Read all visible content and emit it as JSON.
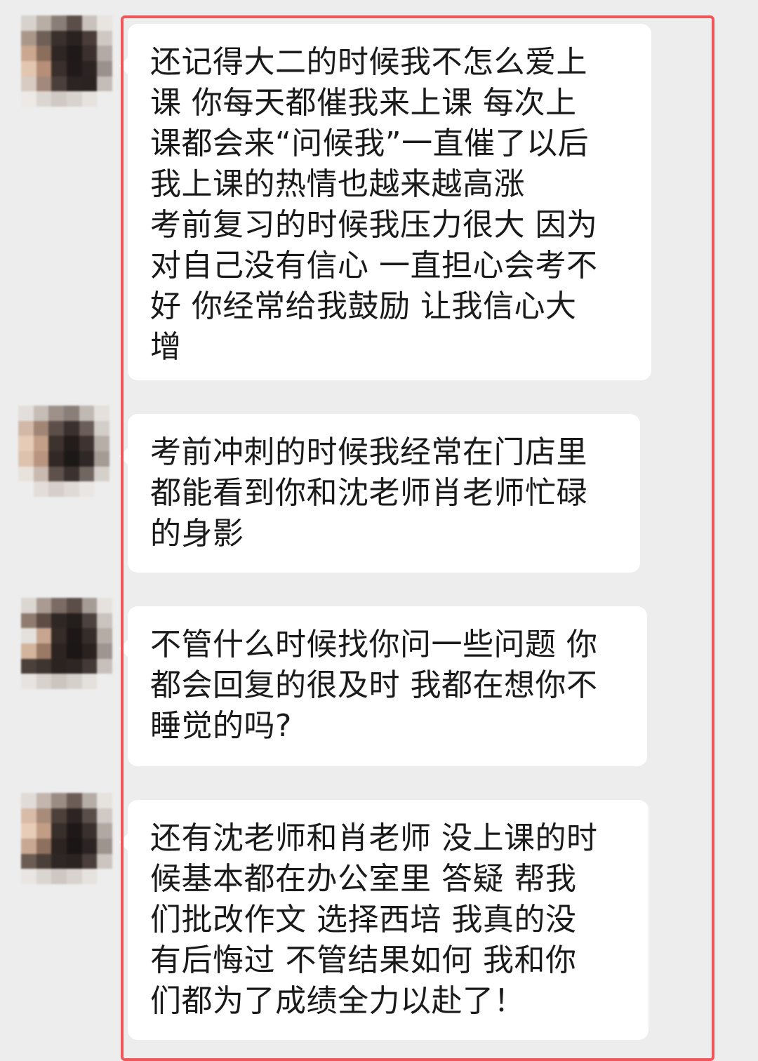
{
  "chat": {
    "messages": [
      {
        "sender": "contact",
        "text": "还记得大二的时候我不怎么爱上\n课  你每天都催我来上课 每次上\n课都会来“问候我”一直催了以后\n我上课的热情也越来越高涨\n考前复习的时候我压力很大 因为\n对自己没有信心 一直担心会考不\n好 你经常给我鼓励 让我信心大\n增"
      },
      {
        "sender": "contact",
        "text": "考前冲刺的时候我经常在门店里\n都能看到你和沈老师肖老师忙碌\n的身影"
      },
      {
        "sender": "contact",
        "text": "不管什么时候找你问一些问题 你\n都会回复的很及时 我都在想你不\n睡觉的吗?"
      },
      {
        "sender": "contact",
        "text": "还有沈老师和肖老师 没上课的时\n候基本都在办公室里 答疑 帮我\n们批改作文 选择西培 我真的没\n有后悔过 不管结果如何 我和你\n们都为了成绩全力以赴了！"
      }
    ]
  },
  "colors": {
    "background": "#ededed",
    "bubble": "#ffffff",
    "text": "#1a1a1a",
    "highlight_border": "#f0575b"
  },
  "avatar_icon": "pixelated-avatar-icon"
}
